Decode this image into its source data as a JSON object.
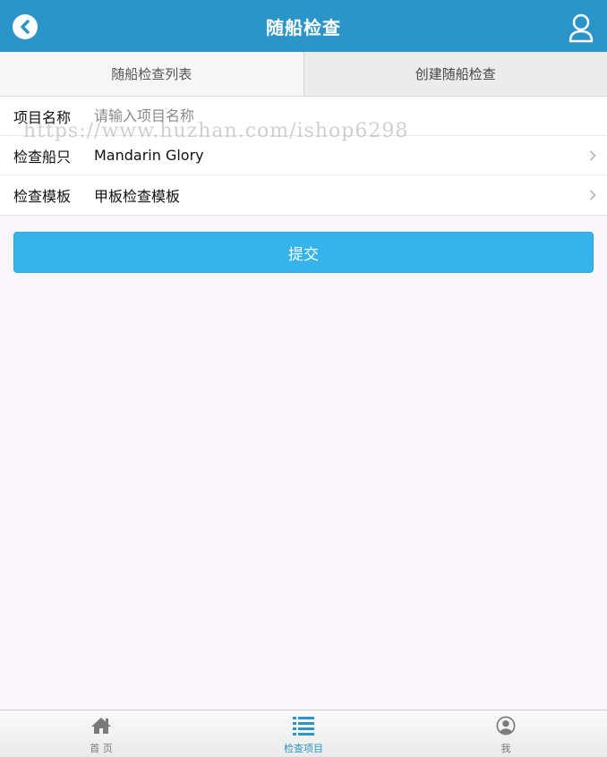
{
  "header": {
    "title": "随船检查",
    "back_icon": "chevron-left-circle-icon",
    "user_icon": "user-outline-icon"
  },
  "tabs": [
    {
      "label": "随船检查列表",
      "active": false
    },
    {
      "label": "创建随船检查",
      "active": true
    }
  ],
  "form": {
    "project_name": {
      "label": "项目名称",
      "placeholder": "请输入项目名称",
      "value": ""
    },
    "ship": {
      "label": "检查船只",
      "value": "Mandarin Glory"
    },
    "template": {
      "label": "检查模板",
      "value": "甲板检查模板"
    }
  },
  "watermark": "https://www.huzhan.com/ishop6298",
  "submit_label": "提交",
  "tabbar": [
    {
      "label": "首 页",
      "icon": "home-icon",
      "active": false
    },
    {
      "label": "检查项目",
      "icon": "list-icon",
      "active": true
    },
    {
      "label": "我",
      "icon": "user-circle-icon",
      "active": false
    }
  ],
  "colors": {
    "header_bg": "#2b95c9",
    "button_bg": "#35b4ec",
    "active_tab": "#2b95c9"
  }
}
